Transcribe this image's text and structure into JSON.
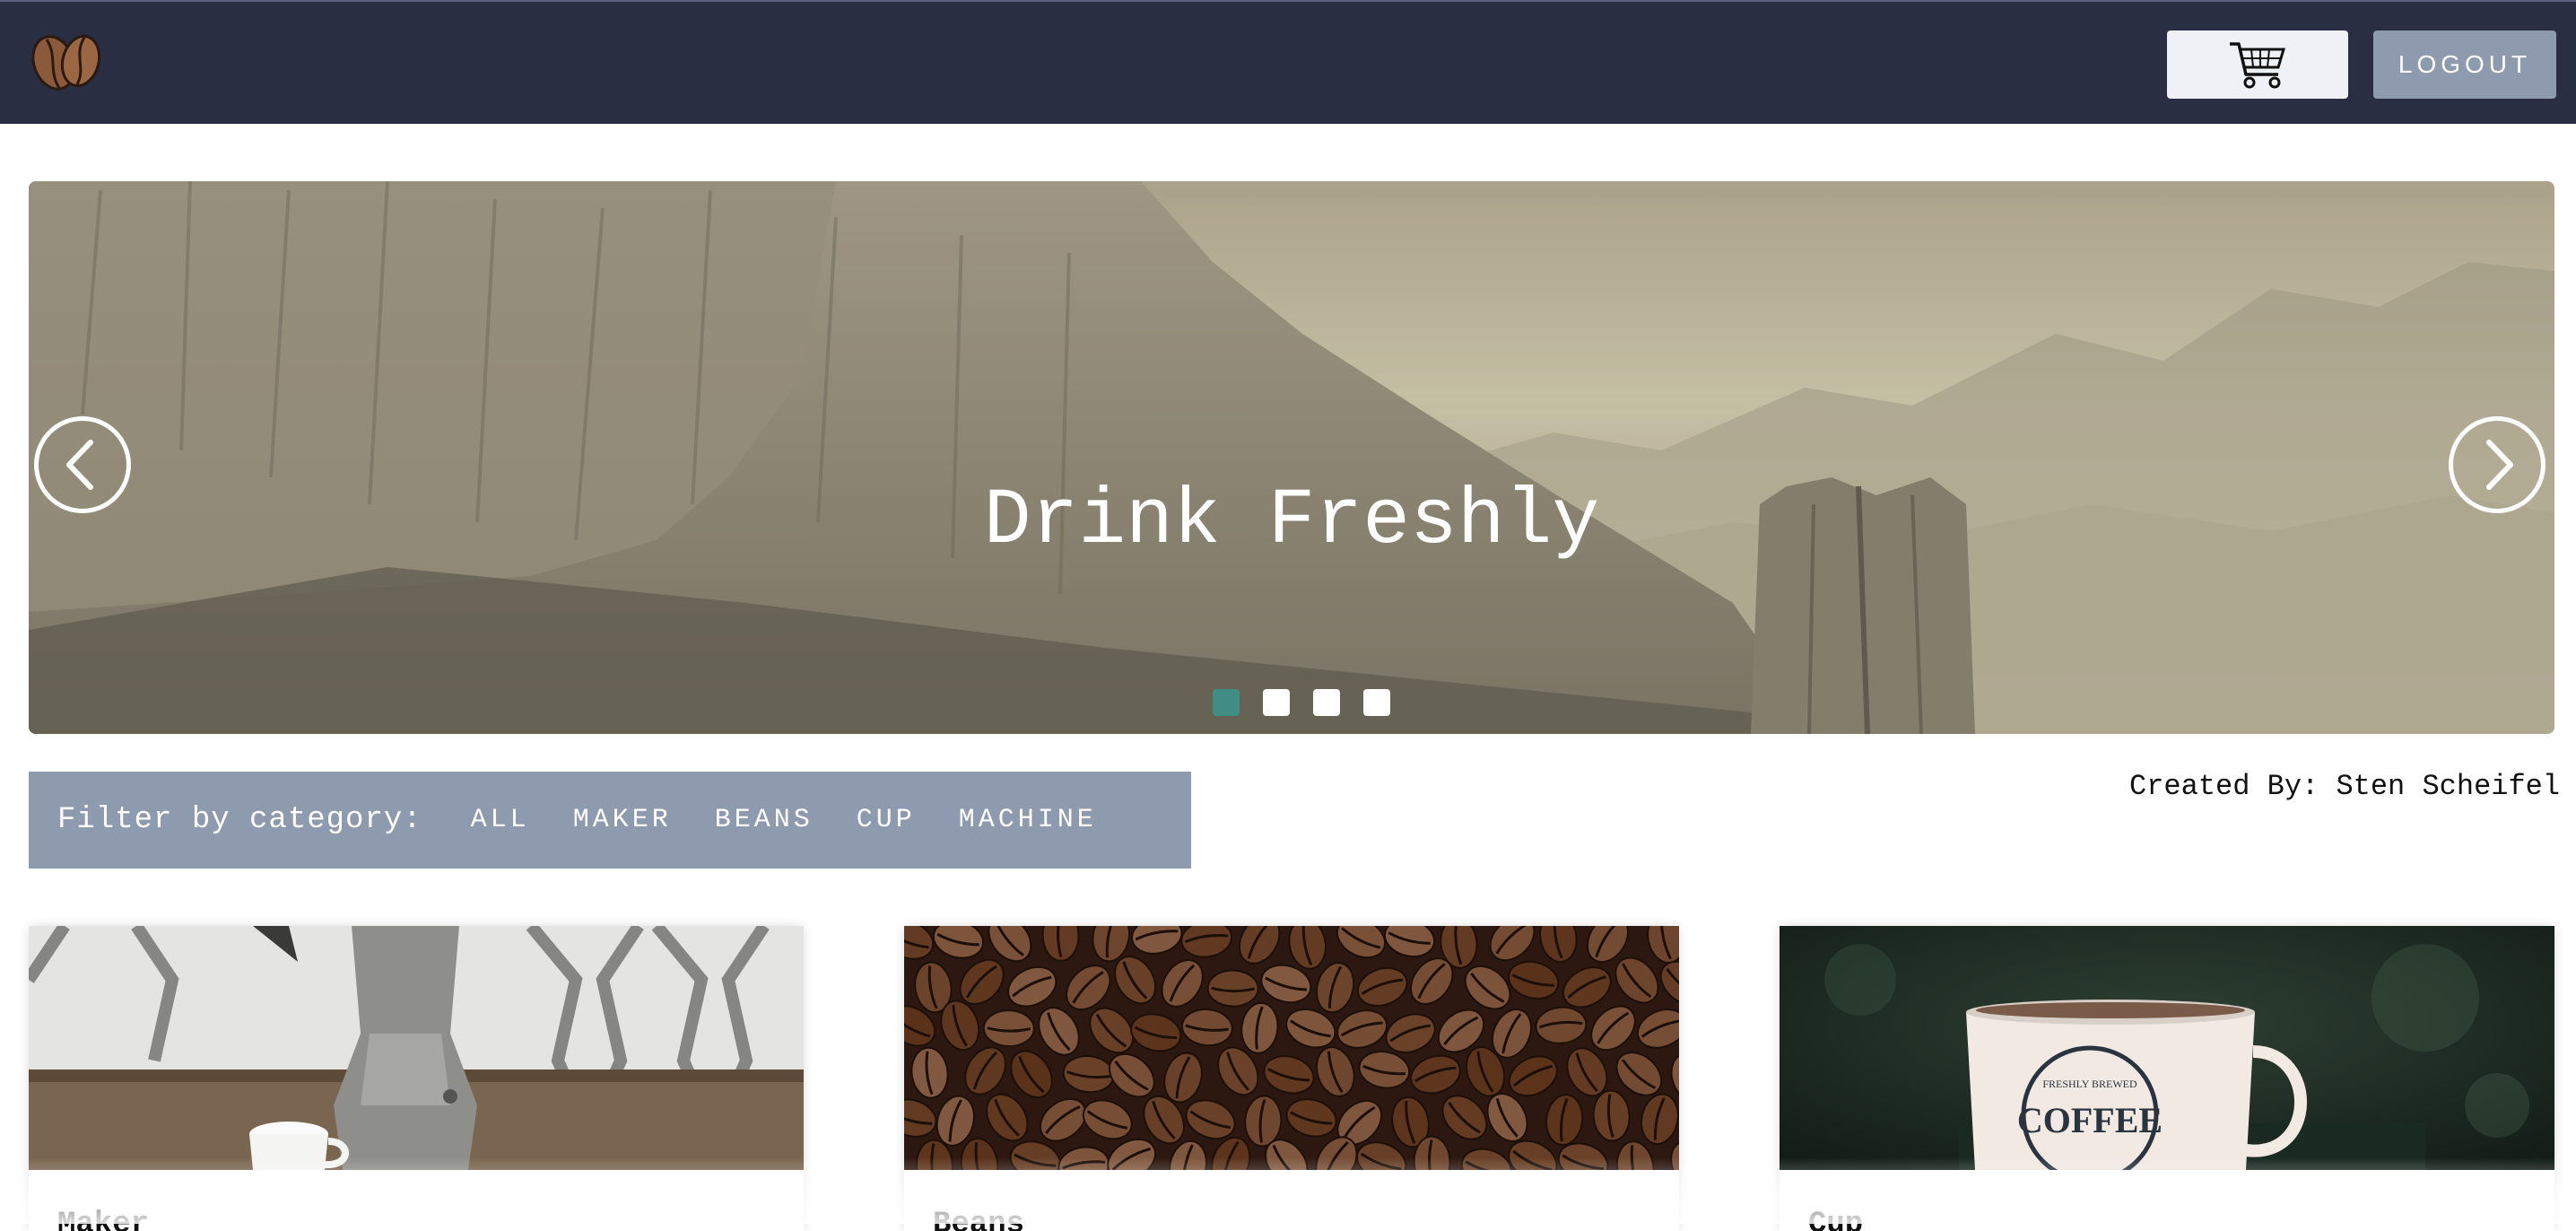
{
  "header": {
    "logo_icon": "coffee-beans-icon",
    "cart_icon": "shopping-cart-icon",
    "logout_label": "LOGOUT",
    "background": "#2a2e43"
  },
  "carousel": {
    "slide_title": "Drink Freshly",
    "prev_icon": "chevron-left-icon",
    "next_icon": "chevron-right-icon",
    "slide_count": 4,
    "active_slide": 1,
    "active_dot_color": "#3f8d85"
  },
  "filter": {
    "label": "Filter by category:",
    "categories": [
      "ALL",
      "MAKER",
      "BEANS",
      "CUP",
      "MACHINE"
    ],
    "background": "#8e9aae"
  },
  "credit": "Created By: Sten Scheifel",
  "products": [
    {
      "title": "Maker"
    },
    {
      "title": "Beans"
    },
    {
      "title": "Cup"
    }
  ]
}
